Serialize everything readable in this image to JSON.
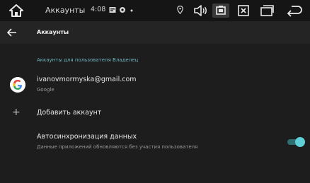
{
  "statusbar": {
    "title": "Аккаунты",
    "time": "4:08",
    "icons": [
      "home-icon",
      "image-icon",
      "gear-icon",
      "dot-icon",
      "location-icon",
      "volume-icon",
      "screenshot-icon",
      "close-box-icon",
      "windows-icon",
      "back-arrow-icon"
    ]
  },
  "toolbar": {
    "title": "Аккаунты"
  },
  "section": {
    "header": "Аккаунты для пользователя Владелец"
  },
  "account": {
    "email": "ivanovmormyska@gmail.com",
    "type": "Google"
  },
  "add": {
    "label": "Добавить аккаунт",
    "icon": "+"
  },
  "sync": {
    "title": "Автосинхронизация данных",
    "subtitle": "Данные приложений обновляются без участия пользователя",
    "enabled": true
  },
  "colors": {
    "accent": "#5fd0d8",
    "section": "#6fb6c2",
    "background": "#1d1d1d"
  }
}
